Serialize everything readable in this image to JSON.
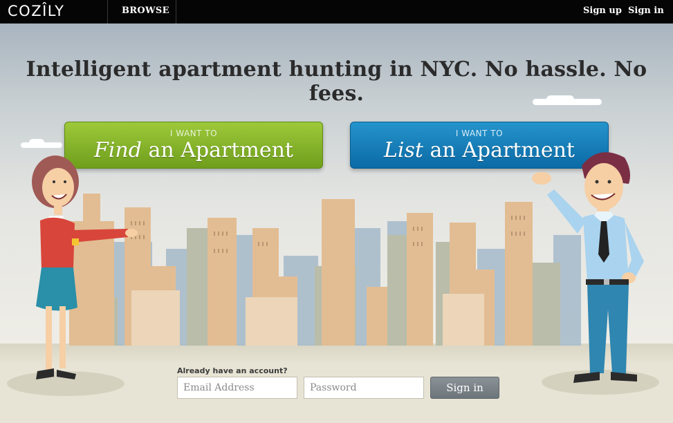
{
  "topbar": {
    "logo": "COZÎLY",
    "browse": "BROWSE",
    "sign_up": "Sign up",
    "sign_in": "Sign in"
  },
  "hero": {
    "headline": "Intelligent apartment hunting in NYC. No hassle. No fees.",
    "find": {
      "small": "I WANT TO",
      "verb": "Find",
      "rest": " an Apartment"
    },
    "list": {
      "small": "I WANT TO",
      "verb": "List",
      "rest": " an Apartment"
    }
  },
  "login": {
    "prompt": "Already have an account?",
    "email_placeholder": "Email Address",
    "password_placeholder": "Password",
    "submit": "Sign in"
  },
  "colors": {
    "find_button": "#7fae26",
    "list_button": "#1680bb",
    "topbar": "#050505"
  }
}
